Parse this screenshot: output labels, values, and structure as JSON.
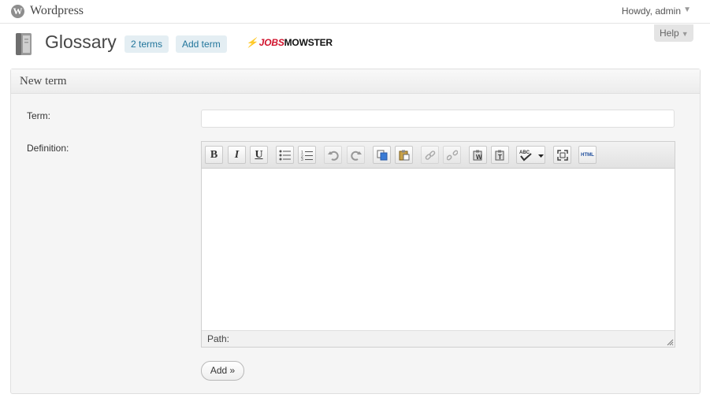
{
  "adminbar": {
    "site_name": "Wordpress",
    "greeting": "Howdy, admin",
    "logo_letter": "W"
  },
  "header": {
    "title": "Glossary",
    "links": [
      {
        "label": "2 terms"
      },
      {
        "label": "Add term"
      }
    ],
    "brand": {
      "part1": "JOBS",
      "part2": "MOWSTER"
    },
    "help_label": "Help"
  },
  "form": {
    "box_title": "New term",
    "term_label": "Term:",
    "term_value": "",
    "definition_label": "Definition:",
    "editor_path_label": "Path:",
    "submit_label": "Add »"
  },
  "toolbar": {
    "buttons": [
      {
        "name": "bold",
        "glyph": "B"
      },
      {
        "name": "italic",
        "glyph": "I"
      },
      {
        "name": "underline",
        "glyph": "U"
      },
      {
        "name": "bullet-list-icon"
      },
      {
        "name": "numbered-list-icon"
      },
      {
        "name": "undo-icon"
      },
      {
        "name": "redo-icon"
      },
      {
        "name": "copy-icon"
      },
      {
        "name": "paste-icon"
      },
      {
        "name": "link-icon"
      },
      {
        "name": "unlink-icon"
      },
      {
        "name": "paste-word-icon",
        "glyph": "W"
      },
      {
        "name": "paste-text-icon",
        "glyph": "T"
      },
      {
        "name": "spellcheck-icon",
        "glyph": "ABC"
      },
      {
        "name": "fullscreen-icon"
      },
      {
        "name": "html-icon",
        "glyph": "HTML"
      }
    ]
  },
  "colors": {
    "link": "#21759b",
    "link_bg": "#e4eef3",
    "brand_red": "#d0112b",
    "panel_bg": "#f5f5f5"
  }
}
